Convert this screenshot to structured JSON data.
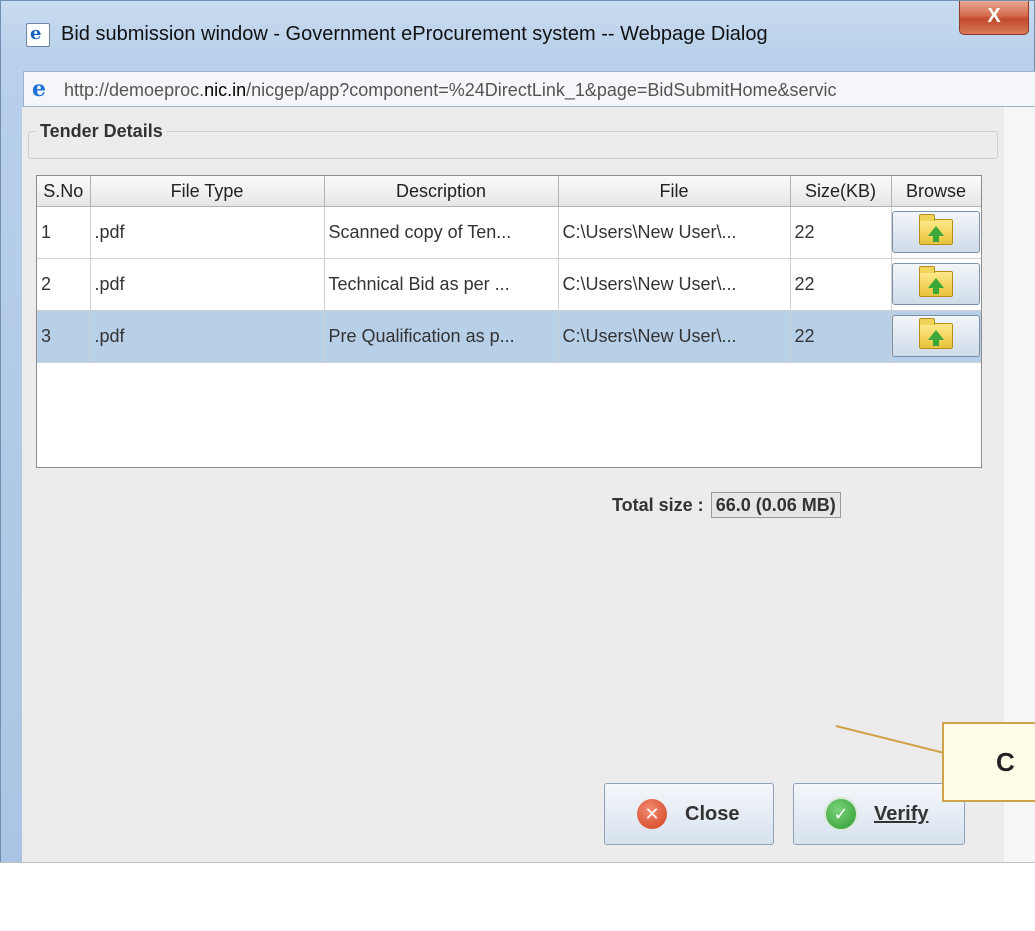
{
  "window": {
    "title": "Bid submission window - Government eProcurement system -- Webpage Dialog",
    "close_glyph": "X"
  },
  "address": {
    "url_prefix": "http://demoeproc.",
    "url_host": "nic.in",
    "url_suffix": "/nicgep/app?component=%24DirectLink_1&page=BidSubmitHome&servic"
  },
  "group": {
    "legend": "Tender Details"
  },
  "table": {
    "headers": [
      "S.No",
      "File Type",
      "Description",
      "File",
      "Size(KB)",
      "Browse"
    ],
    "rows": [
      {
        "sno": "1",
        "file_type": ".pdf",
        "description": "Scanned copy of Ten...",
        "file": "C:\\Users\\New User\\...",
        "size": "22",
        "selected": false
      },
      {
        "sno": "2",
        "file_type": ".pdf",
        "description": "Technical Bid as per ...",
        "file": "C:\\Users\\New User\\...",
        "size": "22",
        "selected": false
      },
      {
        "sno": "3",
        "file_type": ".pdf",
        "description": "Pre Qualification as p...",
        "file": "C:\\Users\\New User\\...",
        "size": "22",
        "selected": true
      }
    ]
  },
  "total": {
    "label": "Total size :",
    "value": "66.0 (0.06 MB)"
  },
  "buttons": {
    "close_label": "Close",
    "verify_label": "Verify"
  },
  "callout": {
    "text": "C"
  },
  "colors": {
    "selected_row": "#b8cfe8",
    "title_close": "#c24a2c",
    "callout_border": "#d0a24a"
  },
  "icons": {
    "browse": "folder-upload-icon",
    "close": "close-circle-icon",
    "verify": "check-circle-icon"
  }
}
